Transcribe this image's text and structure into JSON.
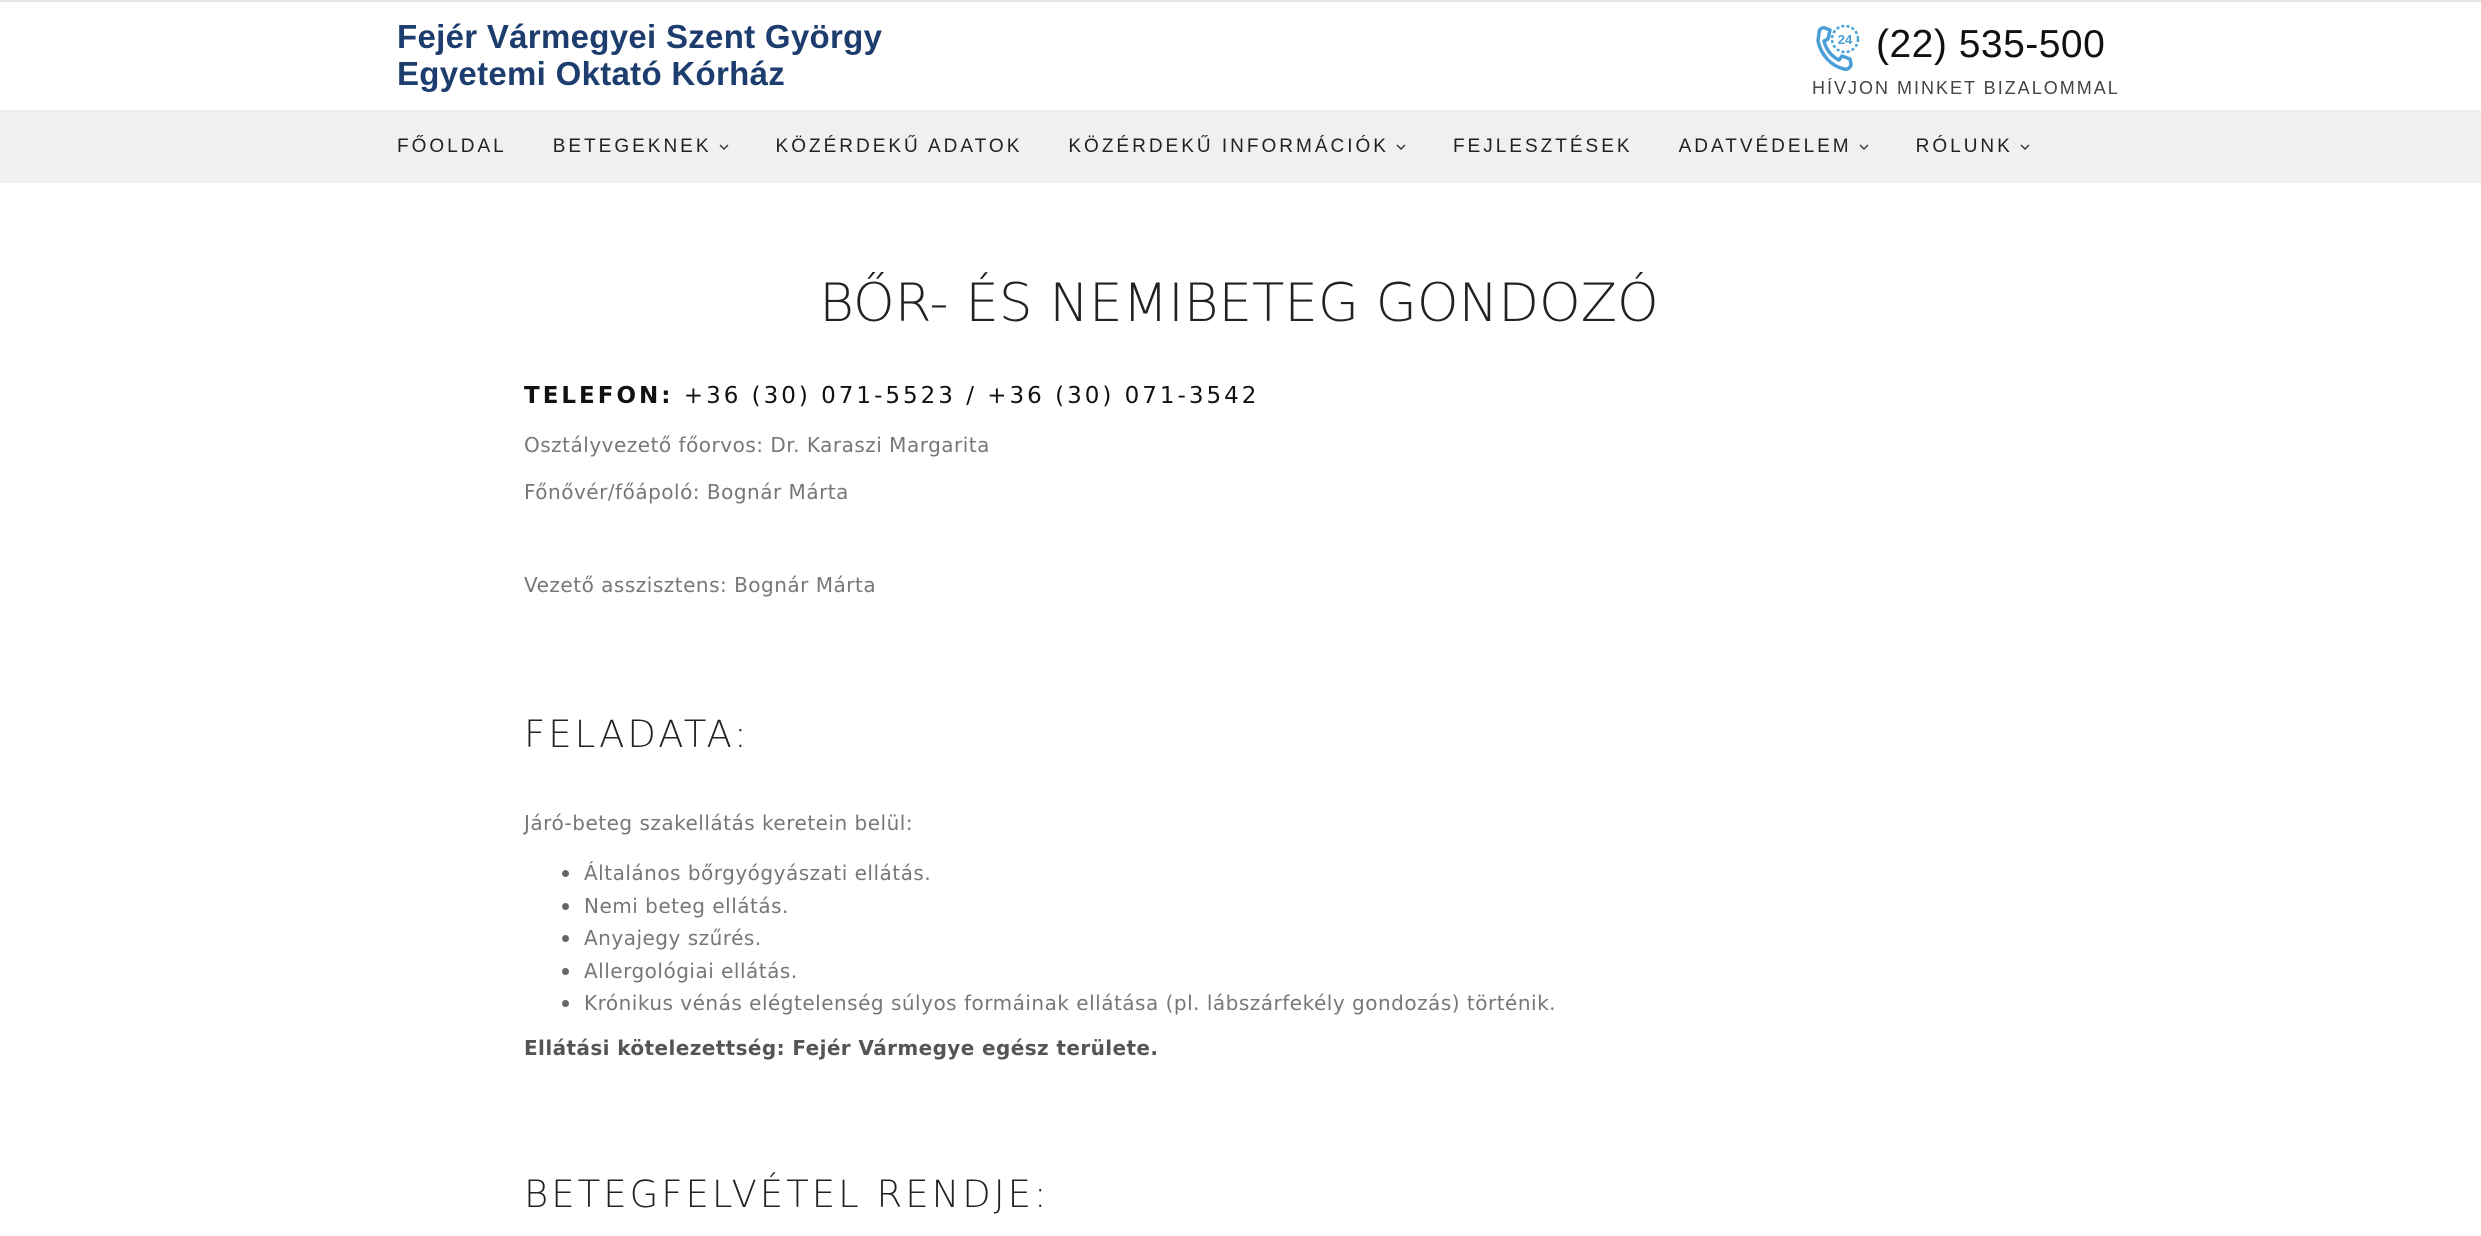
{
  "header": {
    "title_line1": "Fejér Vármegyei Szent György",
    "title_line2": "Egyetemi Oktató Kórház",
    "phone_icon": "phone-24h-icon",
    "phone_number": "(22) 535-500",
    "phone_tagline": "HÍVJON MINKET BIZALOMMAL"
  },
  "nav": {
    "items": [
      {
        "label": "FŐOLDAL",
        "dropdown": false
      },
      {
        "label": "BETEGEKNEK",
        "dropdown": true
      },
      {
        "label": "KÖZÉRDEKŰ ADATOK",
        "dropdown": false
      },
      {
        "label": "KÖZÉRDEKŰ INFORMÁCIÓK",
        "dropdown": true
      },
      {
        "label": "FEJLESZTÉSEK",
        "dropdown": false
      },
      {
        "label": "ADATVÉDELEM",
        "dropdown": true
      },
      {
        "label": "RÓLUNK",
        "dropdown": true
      }
    ]
  },
  "main": {
    "page_title": "BŐR- ÉS NEMIBETEG GONDOZÓ",
    "telefon_label": "TELEFON:",
    "telefon_value": "+36 (30) 071-5523 / +36 (30) 071-3542",
    "head_doctor": "Osztályvezető főorvos: Dr. Karaszi Margarita",
    "head_nurse": "Főnővér/főápoló: Bognár Márta",
    "lead_assistant": "Vezető asszisztens: Bognár Márta",
    "tasks_heading": "FELADATA:",
    "tasks_intro": "Járó-beteg szakellátás keretein belül:",
    "tasks": [
      "Általános bőrgyógyászati ellátás.",
      "Nemi beteg ellátás.",
      "Anyajegy szűrés.",
      "Allergológiai ellátás.",
      "Krónikus vénás elégtelenség súlyos formáinak ellátása (pl. lábszárfekély gondozás) történik."
    ],
    "obligation": "Ellátási kötelezettség: Fejér Vármegye egész területe.",
    "admission_heading": "BETEGFELVÉTEL RENDJE:"
  },
  "colors": {
    "title_blue": "#1d3d6e",
    "nav_bg": "#eff0f2",
    "icon_blue": "#4a9fd8"
  }
}
